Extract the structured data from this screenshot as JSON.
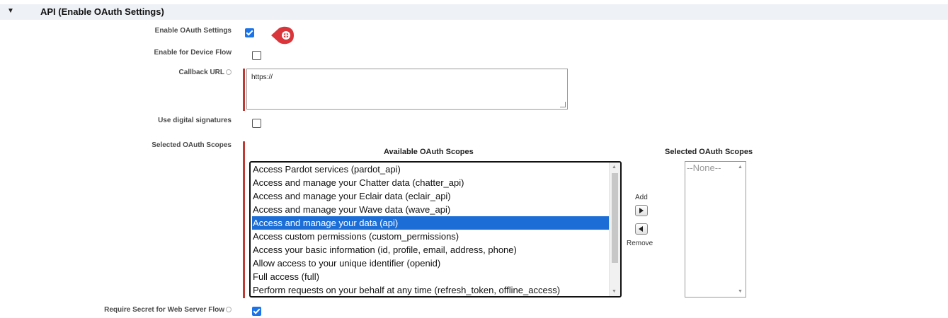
{
  "section": {
    "toggle_glyph": "▼",
    "title": "API (Enable OAuth Settings)"
  },
  "fields": {
    "enable_oauth": {
      "label": "Enable OAuth Settings",
      "checked": true
    },
    "device_flow": {
      "label": "Enable for Device Flow",
      "checked": false
    },
    "callback_url": {
      "label": "Callback URL",
      "value": "https://"
    },
    "digital_signatures": {
      "label": "Use digital signatures",
      "checked": false
    },
    "oauth_scopes": {
      "label": "Selected OAuth Scopes"
    },
    "require_secret": {
      "label": "Require Secret for Web Server Flow",
      "checked": true
    }
  },
  "scopes": {
    "available_title": "Available OAuth Scopes",
    "selected_title": "Selected OAuth Scopes",
    "available": [
      "Access Pardot services (pardot_api)",
      "Access and manage your Chatter data (chatter_api)",
      "Access and manage your Eclair data (eclair_api)",
      "Access and manage your Wave data (wave_api)",
      "Access and manage your data (api)",
      "Access custom permissions (custom_permissions)",
      "Access your basic information (id, profile, email, address, phone)",
      "Allow access to your unique identifier (openid)",
      "Full access (full)",
      "Perform requests on your behalf at any time (refresh_token, offline_access)"
    ],
    "highlighted_index": 4,
    "selected": [
      "--None--"
    ],
    "add_label": "Add",
    "remove_label": "Remove"
  },
  "colors": {
    "required_bar": "#c23934",
    "checkbox_checked": "#1a73e8",
    "selection_highlight": "#1c6ed6",
    "marker": "#d9353a"
  },
  "icons": {
    "section_toggle": "triangle-down-icon",
    "info": "info-icon",
    "marker": "pointer-marker-icon",
    "add": "arrow-right-icon",
    "remove": "arrow-left-icon"
  }
}
